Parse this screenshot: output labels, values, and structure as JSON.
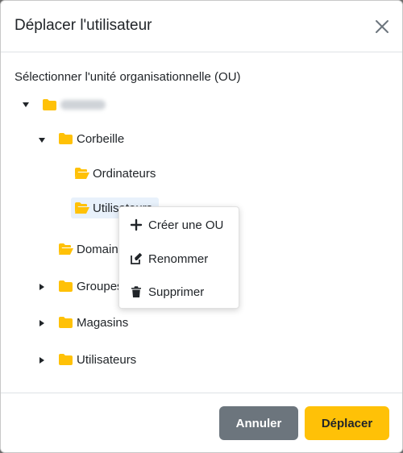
{
  "dialog": {
    "title": "Déplacer l'utilisateur",
    "select_label": "Sélectionner l'unité organisationnelle (OU)"
  },
  "tree": {
    "root": {
      "label": "",
      "expanded": true
    },
    "corbeille": {
      "label": "Corbeille",
      "expanded": true
    },
    "ordinateurs": {
      "label": "Ordinateurs"
    },
    "utilisateurs_selected": {
      "label": "Utilisateurs"
    },
    "domaine": {
      "label": "Domaine"
    },
    "groupes": {
      "label": "Groupes",
      "expanded": false
    },
    "magasins": {
      "label": "Magasins",
      "expanded": false
    },
    "utilisateurs": {
      "label": "Utilisateurs",
      "expanded": false
    }
  },
  "context_menu": {
    "create": "Créer une OU",
    "rename": "Renommer",
    "delete": "Supprimer"
  },
  "footer": {
    "cancel_label": "Annuler",
    "move_label": "Déplacer"
  },
  "colors": {
    "folder": "#ffc107",
    "cancel_bg": "#6c757d",
    "move_bg": "#ffc107",
    "selected_bg": "#e8f1fb"
  }
}
